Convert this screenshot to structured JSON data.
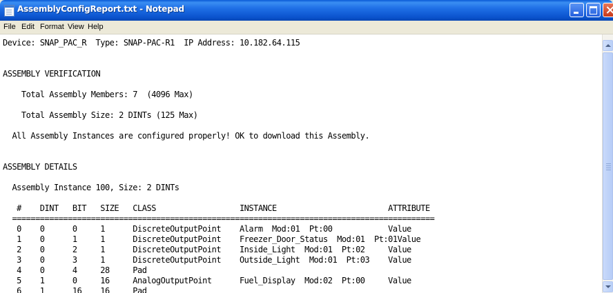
{
  "window": {
    "title": "AssemblyConfigReport.txt - Notepad"
  },
  "menu": {
    "items": [
      "File",
      "Edit",
      "Format",
      "View",
      "Help"
    ]
  },
  "document": {
    "lines": [
      "Device: SNAP_PAC_R  Type: SNAP-PAC-R1  IP Address: 10.182.64.115",
      "",
      "",
      "ASSEMBLY VERIFICATION",
      "",
      "    Total Assembly Members: 7  (4096 Max)",
      "",
      "    Total Assembly Size: 2 DINTs (125 Max)",
      "",
      "  All Assembly Instances are configured properly! OK to download this Assembly.",
      "",
      "",
      "ASSEMBLY DETAILS",
      "",
      "  Assembly Instance 100, Size: 2 DINTs",
      "",
      "   #    DINT   BIT   SIZE   CLASS                  INSTANCE                        ATTRIBUTE",
      "  ===========================================================================================",
      "   0    0      0     1      DiscreteOutputPoint    Alarm  Mod:01  Pt:00            Value",
      "   1    0      1     1      DiscreteOutputPoint    Freezer_Door_Status  Mod:01  Pt:01Value",
      "   2    0      2     1      DiscreteOutputPoint    Inside_Light  Mod:01  Pt:02     Value",
      "   3    0      3     1      DiscreteOutputPoint    Outside_Light  Mod:01  Pt:03    Value",
      "   4    0      4     28     Pad",
      "   5    1      0     16     AnalogOutputPoint      Fuel_Display  Mod:02  Pt:00     Value",
      "   6    1      16    16     Pad"
    ]
  }
}
